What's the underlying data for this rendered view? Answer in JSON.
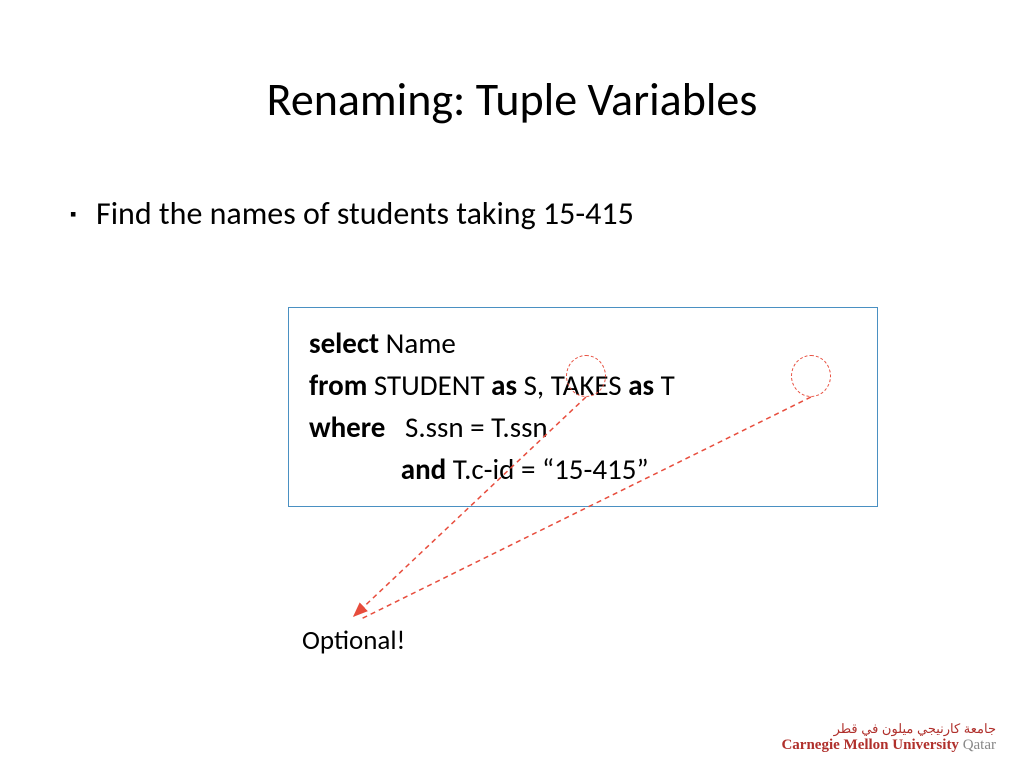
{
  "title": "Renaming: Tuple Variables",
  "bullet_marker": "▪",
  "bullet_text": "Find the names of students taking 15-415",
  "code": {
    "l1_kw": "select",
    "l1_rest": " Name",
    "l2_kw1": "from",
    "l2_p1": " STUDENT ",
    "l2_kw2": "as",
    "l2_p2": " S, TAKES ",
    "l2_kw3": "as",
    "l2_p3": " T",
    "l3_kw": "where",
    "l3_rest": "   S.ssn = T.ssn",
    "l4_pad": "              ",
    "l4_kw": "and",
    "l4_rest": " T.c-id = “15-415”"
  },
  "optional_label": "Optional!",
  "logo": {
    "arabic": "جامعة كارنيجي ميلون في قطر",
    "en1": "Carnegie Mellon University ",
    "en2": "Qatar"
  }
}
